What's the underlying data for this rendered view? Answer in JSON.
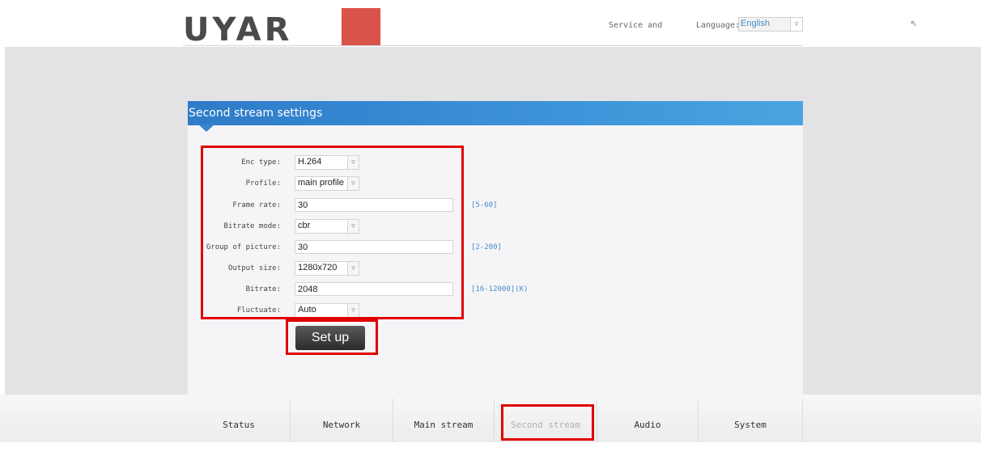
{
  "header": {
    "logo_text": "UYAR",
    "service_text": "Service and",
    "language_label": "Language:",
    "language_value": "English"
  },
  "panel": {
    "title": "Second stream settings"
  },
  "form": {
    "enc_type_label": "Enc type:",
    "enc_type_value": "H.264",
    "profile_label": "Profile:",
    "profile_value": "main profile",
    "frame_rate_label": "Frame rate:",
    "frame_rate_value": "30",
    "frame_rate_hint": "[5-60]",
    "bitrate_mode_label": "Bitrate mode:",
    "bitrate_mode_value": "cbr",
    "gop_label": "Group of picture:",
    "gop_value": "30",
    "gop_hint": "[2-200]",
    "output_size_label": "Output size:",
    "output_size_value": "1280x720",
    "bitrate_label": "Bitrate:",
    "bitrate_value": "2048",
    "bitrate_hint": "[16-12000](K)",
    "fluctuate_label": "Fluctuate:",
    "fluctuate_value": "Auto",
    "setup_label": "Set up"
  },
  "nav": {
    "items": [
      "Status",
      "Network",
      "Main stream",
      "Second stream",
      "Audio",
      "System"
    ],
    "active": "Second stream"
  },
  "colors": {
    "panel_header": "#3a8fd6",
    "highlight_red": "#e00000",
    "hint_blue": "#4a8acb"
  }
}
